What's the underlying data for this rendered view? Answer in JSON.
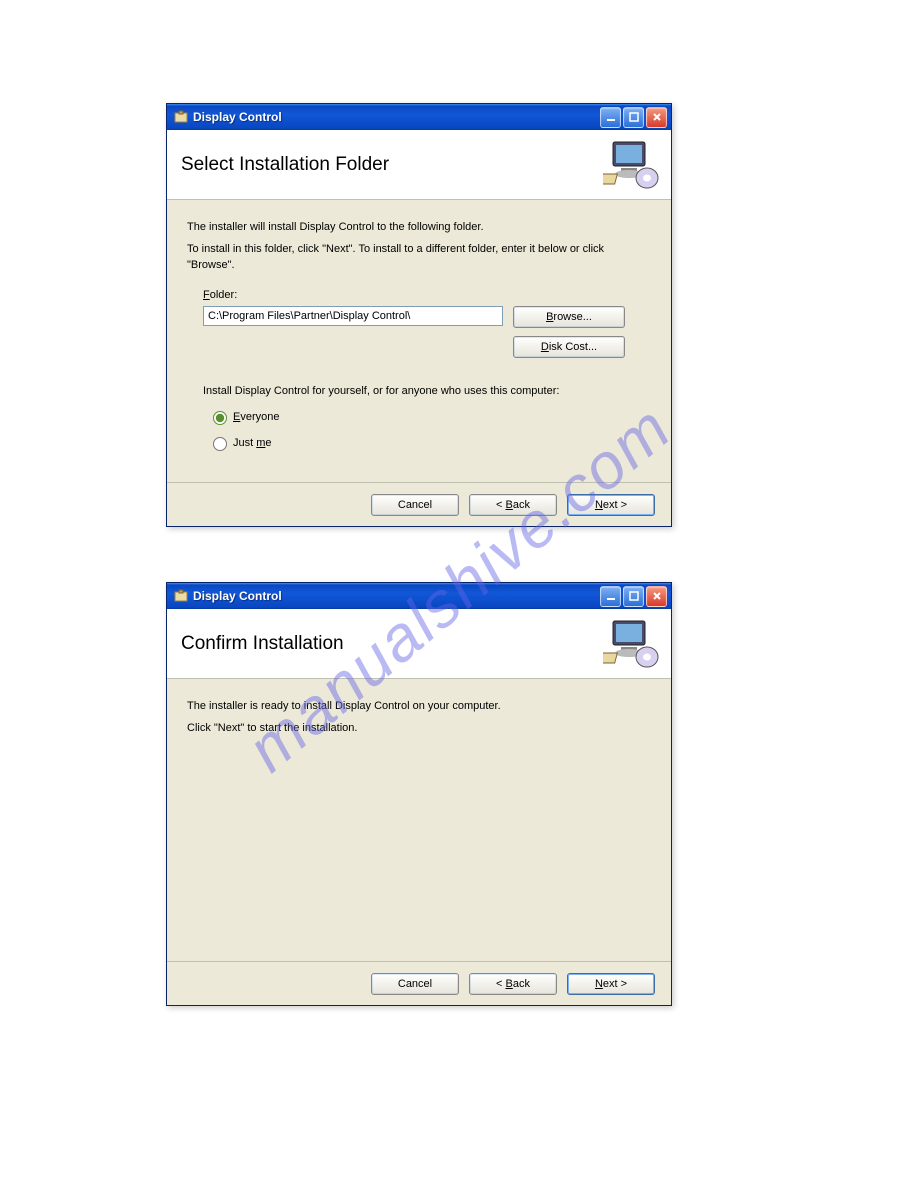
{
  "watermark": "manualshive.com",
  "dialog1": {
    "title": "Display Control",
    "header": "Select Installation Folder",
    "body_line1": "The installer will install Display Control to the following folder.",
    "body_line2": "To install in this folder, click \"Next\". To install to a different folder, enter it below or click \"Browse\".",
    "folder_label_pre": "F",
    "folder_label_post": "older:",
    "folder_value": "C:\\Program Files\\Partner\\Display Control\\",
    "browse_pre": "B",
    "browse_post": "rowse...",
    "diskcost_pre": "D",
    "diskcost_post": "isk Cost...",
    "install_for_label": "Install Display Control for yourself, or for anyone who uses this computer:",
    "radio_everyone_pre": "E",
    "radio_everyone_post": "veryone",
    "radio_justme_pre": "Just ",
    "radio_justme_accel": "m",
    "radio_justme_post": "e",
    "buttons": {
      "cancel": "Cancel",
      "back_pre": "< ",
      "back_accel": "B",
      "back_post": "ack",
      "next_accel": "N",
      "next_post": "ext >"
    }
  },
  "dialog2": {
    "title": "Display Control",
    "header": "Confirm Installation",
    "body_line1": "The installer is ready to install Display Control on your computer.",
    "body_line2": "Click \"Next\" to start the installation.",
    "buttons": {
      "cancel": "Cancel",
      "back_pre": "< ",
      "back_accel": "B",
      "back_post": "ack",
      "next_accel": "N",
      "next_post": "ext >"
    }
  }
}
